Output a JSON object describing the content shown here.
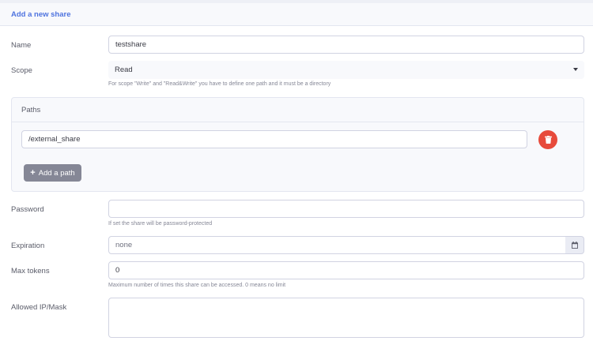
{
  "header": {
    "title": "Add a new share"
  },
  "form": {
    "name": {
      "label": "Name",
      "value": "testshare"
    },
    "scope": {
      "label": "Scope",
      "selected": "Read",
      "help": "For scope \"Write\" and \"Read&Write\" you have to define one path and it must be a directory"
    },
    "paths": {
      "title": "Paths",
      "items": [
        {
          "value": "/external_share"
        }
      ],
      "add_label": "Add a path"
    },
    "password": {
      "label": "Password",
      "value": "",
      "help": "If set the share will be password-protected"
    },
    "expiration": {
      "label": "Expiration",
      "value": "none"
    },
    "max_tokens": {
      "label": "Max tokens",
      "value": "0",
      "help": "Maximum number of times this share can be accessed. 0 means no limit"
    },
    "allowed_ip": {
      "label": "Allowed IP/Mask",
      "value": ""
    }
  },
  "colors": {
    "accent": "#4e73df",
    "danger": "#e74a3b",
    "secondary": "#858796"
  },
  "icons": {
    "delete": "trash-icon",
    "add": "plus-icon",
    "calendar": "calendar-icon",
    "dropdown": "caret-down-icon"
  }
}
